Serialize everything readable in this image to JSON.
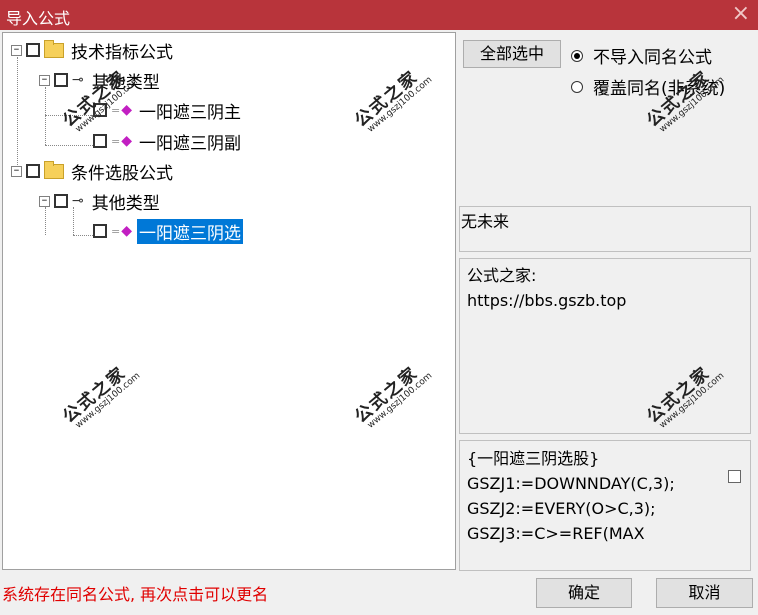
{
  "window": {
    "title": "导入公式",
    "close_icon": "×"
  },
  "tree": {
    "group1": {
      "label": "技术指标公式",
      "sub": {
        "label": "其他类型",
        "items": [
          "一阳遮三阴主",
          "一阳遮三阴副"
        ]
      }
    },
    "group2": {
      "label": "条件选股公式",
      "sub": {
        "label": "其他类型",
        "items": [
          "一阳遮三阴选"
        ]
      }
    },
    "expand_glyph": "−"
  },
  "right": {
    "select_all_label": "全部选中",
    "radio1": "不导入同名公式",
    "radio2": "覆盖同名(非系统)",
    "author": "无未来",
    "info_lines": [
      "公式之家:",
      "https://bbs.gszb.top"
    ],
    "code_lines": [
      "{一阳遮三阴选股}",
      "GSZJ1:=DOWNNDAY(C,3);",
      "GSZJ2:=EVERY(O>C,3);",
      "GSZJ3:=C>=REF(MAX"
    ]
  },
  "status_text": "系统存在同名公式, 再次点击可以更名",
  "buttons": {
    "ok": "确定",
    "cancel": "取消"
  },
  "watermark": {
    "text": "公式之家",
    "url": "www.gszj100.com"
  }
}
